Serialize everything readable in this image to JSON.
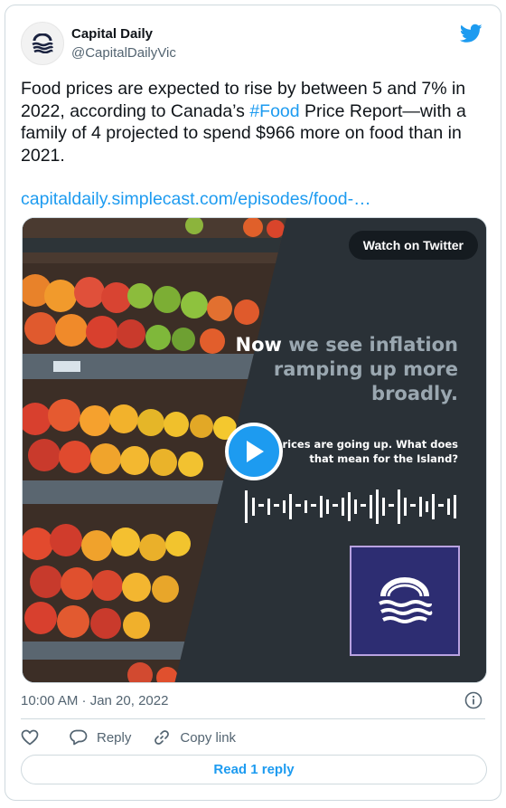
{
  "author": {
    "name": "Capital Daily",
    "handle": "@CapitalDailyVic"
  },
  "tweet": {
    "text_before": "Food prices are expected to rise by between 5 and 7% in 2022, according to Canada’s ",
    "hashtag": "#Food",
    "text_after": " Price Report—with a family of 4 projected to spend $966 more on food than in 2021.",
    "link": "capitaldaily.simplecast.com/episodes/food-…"
  },
  "media": {
    "watch_label": "Watch on Twitter",
    "quote_bright": "Now",
    "quote_dim": "we see inflation ramping up more broadly.",
    "subtitle": "prices are going up. What does that mean for the Island?"
  },
  "footer": {
    "timestamp": "10:00 AM · Jan 20, 2022",
    "reply_label": "Reply",
    "copy_label": "Copy link",
    "read_reply_label": "Read 1 reply"
  },
  "colors": {
    "accent": "#1d9bf0",
    "logo_bg": "#2d2d72",
    "panel": "#2a3137"
  },
  "icons": {
    "brand": "twitter-bird-icon",
    "info": "info-icon",
    "like": "heart-icon",
    "reply": "reply-bubble-icon",
    "copy": "link-icon",
    "play": "play-icon"
  }
}
